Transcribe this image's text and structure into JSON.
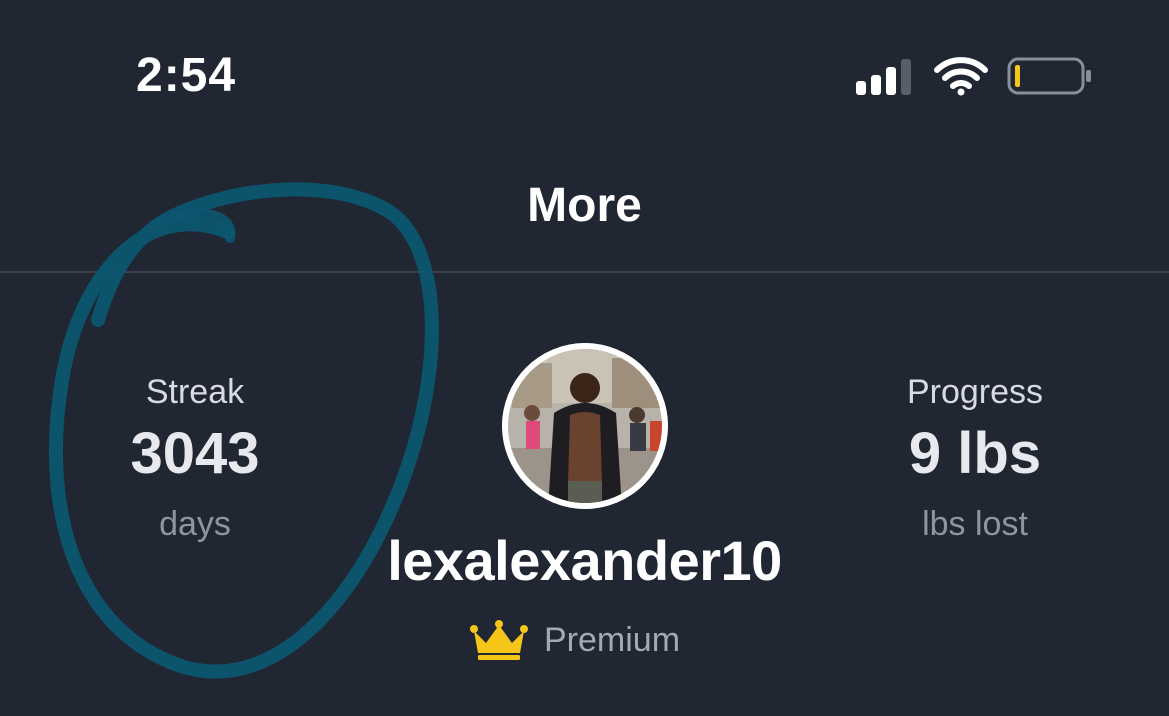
{
  "status_bar": {
    "time": "2:54",
    "icons": [
      "signal-icon",
      "wifi-icon",
      "battery-icon"
    ],
    "battery_color": "#f5c518"
  },
  "nav": {
    "title": "More"
  },
  "streak": {
    "label": "Streak",
    "value": "3043",
    "unit": "days"
  },
  "progress": {
    "label": "Progress",
    "value": "9 lbs",
    "unit": "lbs lost"
  },
  "profile": {
    "username": "lexalexander10",
    "badge_icon": "crown-icon",
    "badge_label": "Premium",
    "badge_color": "#f5c518"
  },
  "annotation": {
    "marker_color": "#0c5670"
  },
  "colors": {
    "background": "#212633",
    "divider": "#3a3f4b"
  }
}
